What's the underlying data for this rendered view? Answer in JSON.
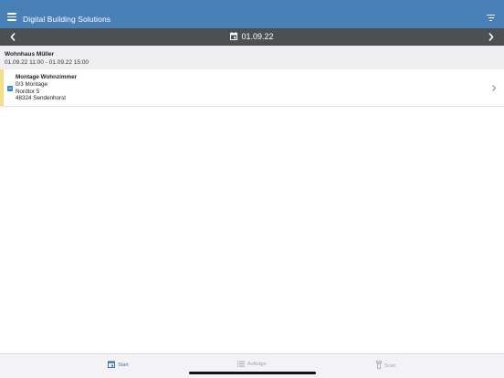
{
  "appbar": {
    "title": "Digital Building Solutions",
    "menu_icon": "hamburger-menu-icon",
    "filter_icon": "filter-icon"
  },
  "datebar": {
    "date": "01.09.22",
    "prev_icon": "chevron-left-icon",
    "next_icon": "chevron-right-icon",
    "calendar_icon": "calendar-icon"
  },
  "group": {
    "name": "Wohnhaus Müller",
    "time_range": "01.09.22 11:00  -  01.09.22 15:00"
  },
  "items": [
    {
      "title": "Montage Wohnzimmer",
      "progress": "0/3 Montage",
      "street": "Nordtor 5",
      "city": "48324 Sendenhorst",
      "badge": "M",
      "stripe_color": "#f2df8a",
      "badge_color": "#2f7fd0"
    }
  ],
  "tabbar": {
    "start": "Start",
    "auftraege": "Aufträge",
    "scan": "Scan"
  },
  "colors": {
    "appbar": "#4a80b8",
    "datebar": "#4d4f53",
    "active_tab": "#3a72ad",
    "inactive_tab": "#a4a4a8"
  }
}
